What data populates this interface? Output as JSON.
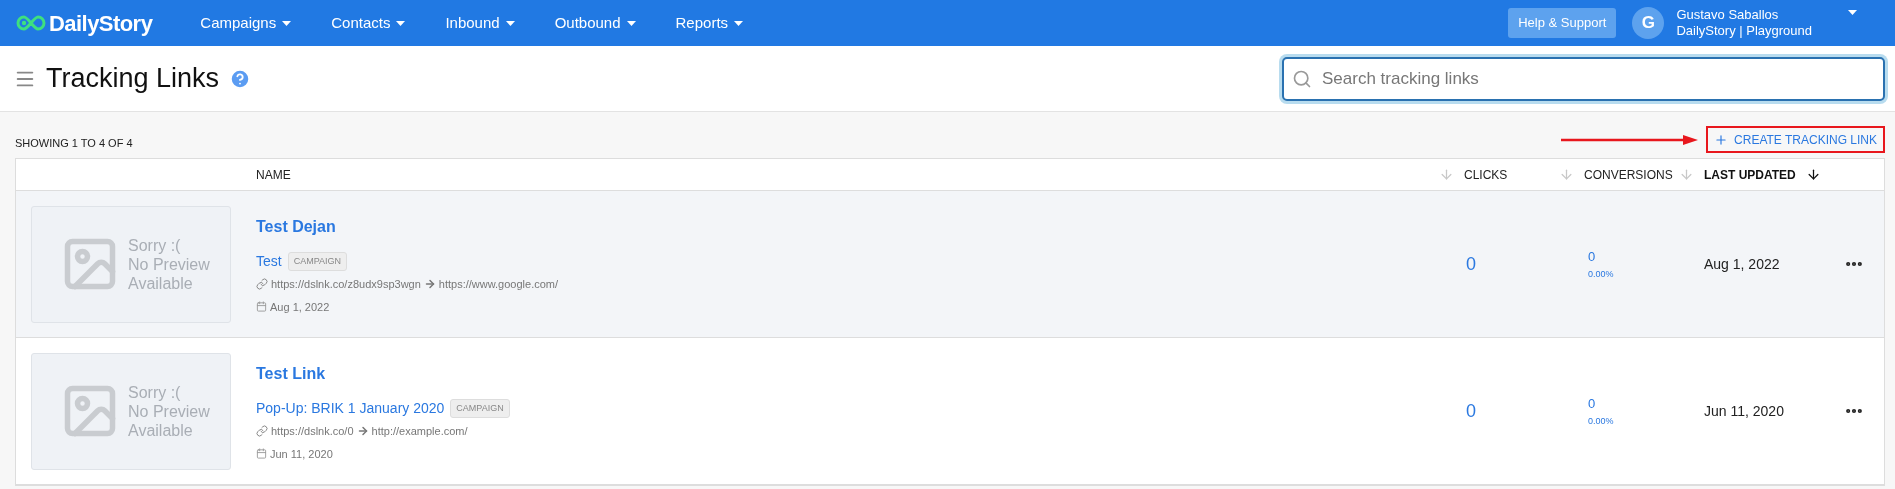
{
  "header": {
    "logo": "DailyStory",
    "nav": [
      {
        "label": "Campaigns"
      },
      {
        "label": "Contacts"
      },
      {
        "label": "Inbound"
      },
      {
        "label": "Outbound"
      },
      {
        "label": "Reports"
      }
    ],
    "help_button": "Help & Support",
    "user": {
      "initial": "G",
      "name": "Gustavo Saballos",
      "account": "DailyStory | Playground"
    }
  },
  "page": {
    "title": "Tracking Links",
    "search": {
      "placeholder": "Search tracking links"
    }
  },
  "summary": "SHOWING 1 TO 4 OF 4",
  "create_button": "CREATE TRACKING LINK",
  "table": {
    "columns": [
      {
        "label": "NAME",
        "selected": false
      },
      {
        "label": "CLICKS",
        "selected": false
      },
      {
        "label": "CONVERSIONS",
        "selected": false
      },
      {
        "label": "LAST UPDATED",
        "selected": true
      }
    ],
    "rows": [
      {
        "hovered": true,
        "preview_text": "Sorry :(\nNo Preview\nAvailable",
        "name": "Test Dejan",
        "source": "Test",
        "tag": "CAMPAIGN",
        "short_url": "https://dslnk.co/z8udx9sp3wgn",
        "destination": "https://www.google.com/",
        "created": "Aug 1, 2022",
        "clicks": "0",
        "conversions": "0",
        "conversion_rate": "0.00%",
        "last_updated": "Aug 1, 2022"
      },
      {
        "hovered": false,
        "preview_text": "Sorry :(\nNo Preview\nAvailable",
        "name": "Test Link",
        "source": "Pop-Up: BRIK 1 January 2020",
        "tag": "CAMPAIGN",
        "short_url": "https://dslnk.co/0",
        "destination": "http://example.com/",
        "created": "Jun 11, 2020",
        "clicks": "0",
        "conversions": "0",
        "conversion_rate": "0.00%",
        "last_updated": "Jun 11, 2020"
      }
    ]
  }
}
